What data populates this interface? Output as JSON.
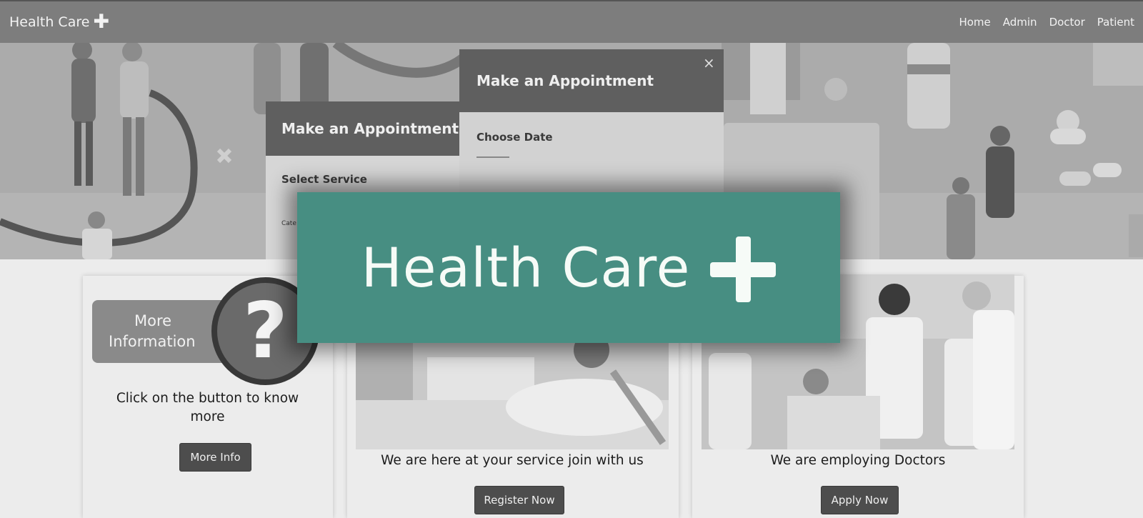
{
  "navbar": {
    "brand": "Health Care",
    "brand_icon": "plus-icon",
    "links": [
      {
        "label": "Home"
      },
      {
        "label": "Admin"
      },
      {
        "label": "Doctor"
      },
      {
        "label": "Patient"
      }
    ]
  },
  "hero": {
    "appointment_front": {
      "title": "Make an Appointment",
      "field": "Select Service",
      "field_small": "Cate"
    },
    "appointment_back": {
      "title": "Make an Appointment",
      "field": "Choose Date",
      "close": "×"
    }
  },
  "cards": {
    "info": {
      "box_line1": "More",
      "box_line2": "Information",
      "question": "?",
      "text": "Click on the button to know more",
      "button": "More Info"
    },
    "register": {
      "text": "We are here at your service join with us",
      "button": "Register Now"
    },
    "doctors": {
      "text": "We are employing Doctors",
      "button": "Apply Now"
    }
  },
  "overlay_logo": {
    "text": "Health Care",
    "icon": "plus-icon",
    "background": "#478e82"
  },
  "colors": {
    "navbar": "#7d7d7d",
    "button": "#4d4d4d",
    "logo_bg": "#478e82"
  }
}
